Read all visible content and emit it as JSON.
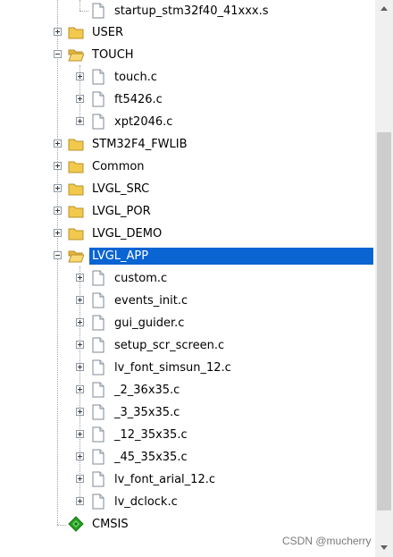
{
  "tree": {
    "startup_file": "startup_stm32f40_41xxx.s",
    "groups": {
      "user": "USER",
      "touch": "TOUCH",
      "stm32f4_fwlib": "STM32F4_FWLIB",
      "common": "Common",
      "lvgl_src": "LVGL_SRC",
      "lvgl_por": "LVGL_POR",
      "lvgl_demo": "LVGL_DEMO",
      "lvgl_app": "LVGL_APP",
      "cmsis": "CMSIS"
    },
    "touch_files": [
      "touch.c",
      "ft5426.c",
      "xpt2046.c"
    ],
    "lvgl_app_files": [
      "custom.c",
      "events_init.c",
      "gui_guider.c",
      "setup_scr_screen.c",
      "lv_font_simsun_12.c",
      "_2_36x35.c",
      "_3_35x35.c",
      "_12_35x35.c",
      "_45_35x35.c",
      "lv_font_arial_12.c",
      "lv_dclock.c"
    ],
    "selected_group": "LVGL_APP"
  },
  "colors": {
    "selection": "#0a64d2",
    "folder": "#f2c94c",
    "cmsis_icon": "#22a020"
  },
  "icons": {
    "folder_closed": "folder-icon",
    "folder_open": "folder-open-icon",
    "file": "file-icon",
    "component": "diamond-component-icon"
  },
  "watermark": "CSDN @mucherry"
}
